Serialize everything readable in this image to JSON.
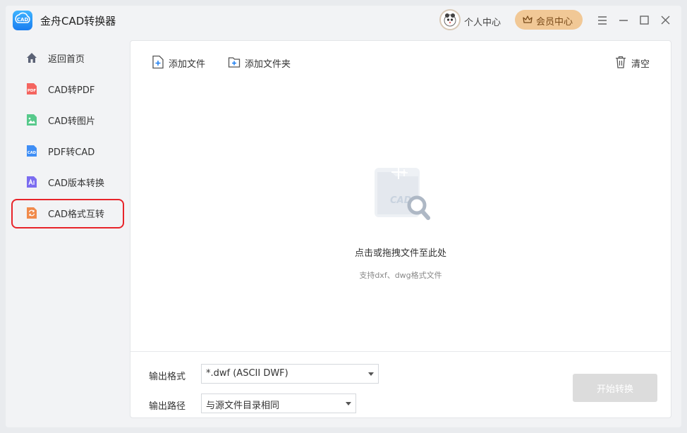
{
  "app": {
    "title": "金舟CAD转换器",
    "logo_text": "CAD"
  },
  "header": {
    "user_center": "个人中心",
    "vip_center": "会员中心"
  },
  "sidebar": {
    "items": [
      {
        "label": "返回首页",
        "icon": "home-icon"
      },
      {
        "label": "CAD转PDF",
        "icon": "pdf-file-icon",
        "badge": "PDF"
      },
      {
        "label": "CAD转图片",
        "icon": "image-file-icon"
      },
      {
        "label": "PDF转CAD",
        "icon": "cad-file-icon",
        "badge": "CAD"
      },
      {
        "label": "CAD版本转换",
        "icon": "version-convert-icon"
      },
      {
        "label": "CAD格式互转",
        "icon": "format-convert-icon"
      }
    ]
  },
  "toolbar": {
    "add_file": "添加文件",
    "add_folder": "添加文件夹",
    "clear": "清空"
  },
  "drop_zone": {
    "title": "点击或拖拽文件至此处",
    "hint": "支持dxf、dwg格式文件",
    "illustration_text": "CAD"
  },
  "output": {
    "format_label": "输出格式",
    "format_value": "*.dwf (ASCII DWF)",
    "path_label": "输出路径",
    "path_value": "与源文件目录相同"
  },
  "start_button": "开始转换",
  "colors": {
    "accent": "#1a7df0",
    "annotation_red": "#e8242a",
    "vip_bg": "#f1c896",
    "disabled": "#dcdcdc"
  }
}
